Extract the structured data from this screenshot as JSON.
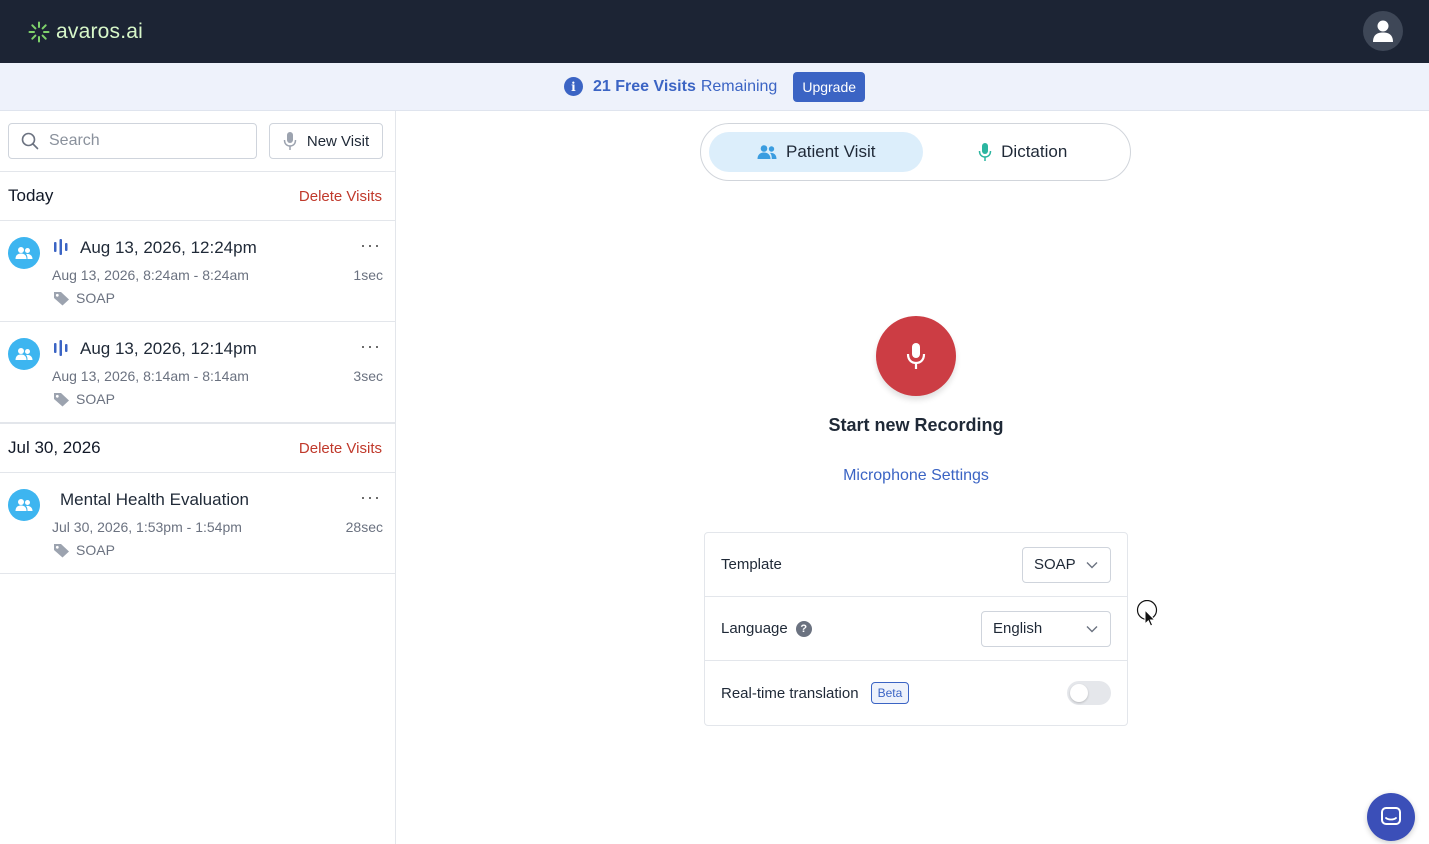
{
  "app": {
    "brand": "avaros.ai"
  },
  "banner": {
    "count_text": "21 Free Visits",
    "remaining_text": "Remaining",
    "upgrade_label": "Upgrade"
  },
  "sidebar": {
    "search": {
      "placeholder": "Search",
      "value": ""
    },
    "new_visit_label": "New Visit",
    "groups": [
      {
        "title": "Today",
        "delete_label": "Delete Visits",
        "visits": [
          {
            "title": "Aug 13, 2026, 12:24pm",
            "time": "Aug 13, 2026, 8:24am - 8:24am",
            "duration": "1sec",
            "tag": "SOAP",
            "more": "···"
          },
          {
            "title": "Aug 13, 2026, 12:14pm",
            "time": "Aug 13, 2026, 8:14am - 8:14am",
            "duration": "3sec",
            "tag": "SOAP",
            "more": "···"
          }
        ]
      },
      {
        "title": "Jul 30, 2026",
        "delete_label": "Delete Visits",
        "visits": [
          {
            "title": "Mental Health Evaluation",
            "time": "Jul 30, 2026, 1:53pm - 1:54pm",
            "duration": "28sec",
            "tag": "SOAP",
            "more": "···"
          }
        ]
      }
    ]
  },
  "main": {
    "tabs": [
      {
        "label": "Patient Visit",
        "active": true
      },
      {
        "label": "Dictation",
        "active": false
      }
    ],
    "record_label": "Start new Recording",
    "mic_settings_label": "Microphone Settings",
    "settings": {
      "template": {
        "label": "Template",
        "value": "SOAP"
      },
      "language": {
        "label": "Language",
        "help": "?",
        "value": "English"
      },
      "translation": {
        "label": "Real-time translation",
        "badge": "Beta",
        "enabled": false
      }
    }
  },
  "colors": {
    "topbar": "#1c2434",
    "accent": "#3b64c4",
    "record": "#cc3d44",
    "danger": "#c0392b",
    "avatar": "#3db5f0"
  }
}
